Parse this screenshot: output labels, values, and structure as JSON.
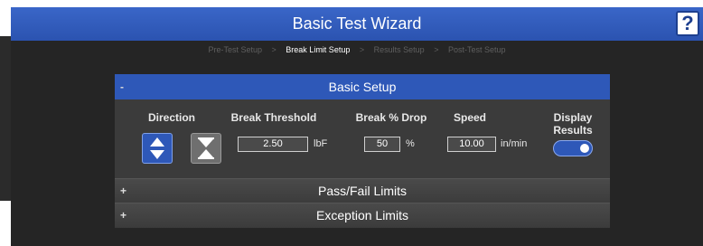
{
  "window": {
    "title": "Basic Test Wizard",
    "help_label": "?"
  },
  "breadcrumb": {
    "steps": [
      "Pre-Test Setup",
      "Break Limit Setup",
      "Results Setup",
      "Post-Test Setup"
    ],
    "active_index": 1,
    "separator": ">"
  },
  "basic_setup": {
    "title": "Basic Setup",
    "toggle": "-",
    "direction": {
      "label": "Direction"
    },
    "break_threshold": {
      "label": "Break Threshold",
      "value": "2.50",
      "unit": "lbF"
    },
    "break_drop": {
      "label": "Break % Drop",
      "value": "50",
      "unit": "%"
    },
    "speed": {
      "label": "Speed",
      "value": "10.00",
      "unit": "in/min"
    },
    "display_results": {
      "label_line1": "Display",
      "label_line2": "Results",
      "enabled": true
    }
  },
  "pass_fail": {
    "title": "Pass/Fail Limits",
    "toggle": "+"
  },
  "exception": {
    "title": "Exception Limits",
    "toggle": "+"
  },
  "colors": {
    "accent": "#2e58b8",
    "background": "#252525",
    "panel": "#3a3a3a"
  }
}
